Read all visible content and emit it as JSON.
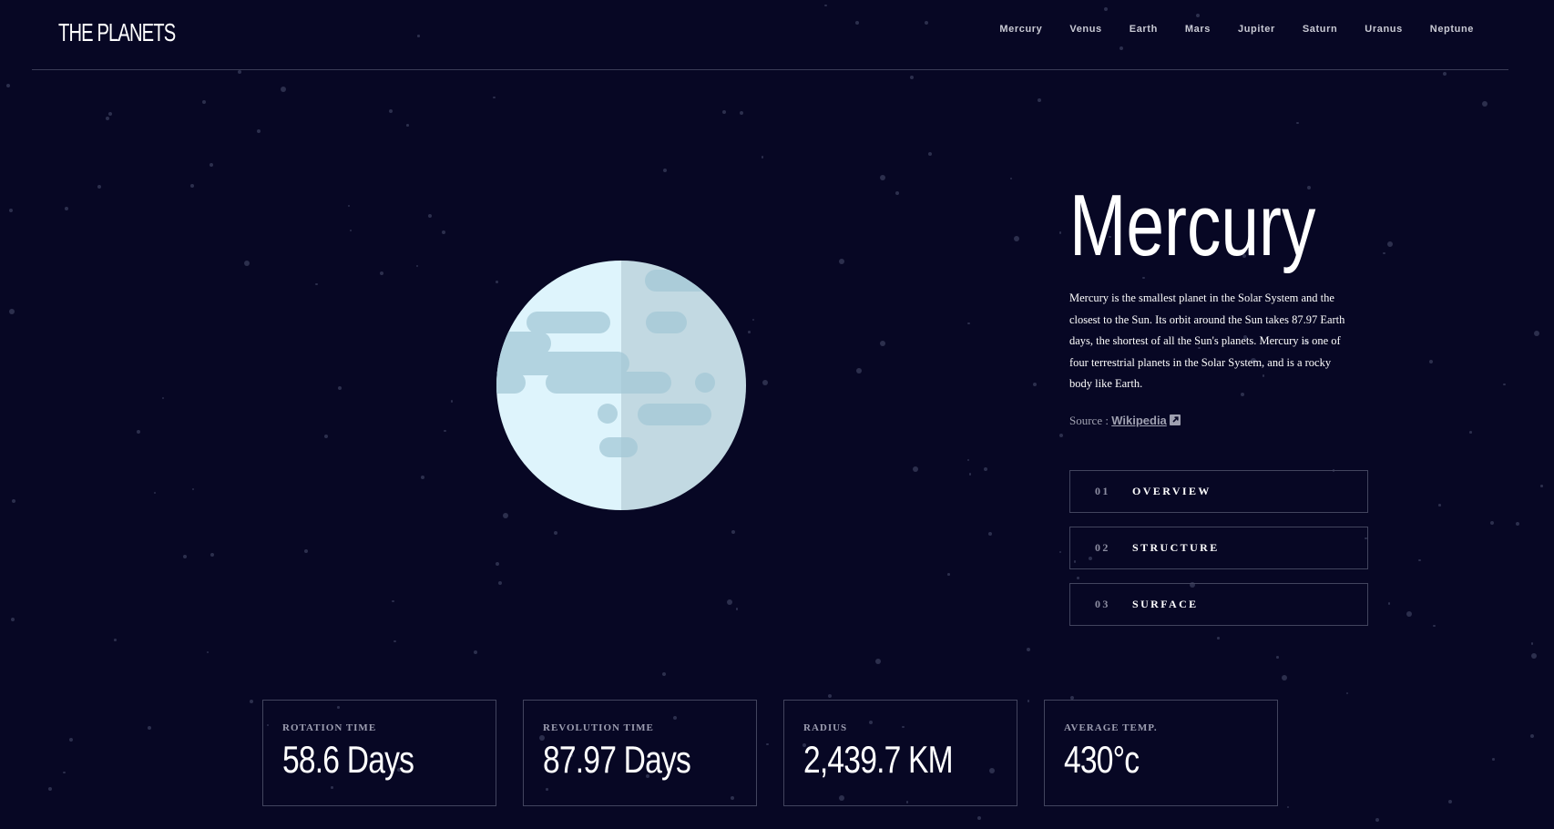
{
  "logo": "THE PLANETS",
  "nav": [
    "Mercury",
    "Venus",
    "Earth",
    "Mars",
    "Jupiter",
    "Saturn",
    "Uranus",
    "Neptune"
  ],
  "planet": {
    "name": "Mercury",
    "description": "Mercury is the smallest planet in the Solar System and the closest to the Sun. Its orbit around the Sun takes 87.97 Earth days, the shortest of all the Sun's planets. Mercury is one of four terrestrial planets in the Solar System, and is a rocky body like Earth.",
    "source_prefix": "Source :",
    "source_link": "Wikipedia"
  },
  "tabs": [
    {
      "num": "01",
      "label": "OVERVIEW"
    },
    {
      "num": "02",
      "label": "STRUCTURE"
    },
    {
      "num": "03",
      "label": "SURFACE"
    }
  ],
  "stats": [
    {
      "label": "ROTATION TIME",
      "value": "58.6 Days"
    },
    {
      "label": "REVOLUTION TIME",
      "value": "87.97 Days"
    },
    {
      "label": "RADIUS",
      "value": "2,439.7 KM"
    },
    {
      "label": "AVERAGE TEMP.",
      "value": "430°c"
    }
  ],
  "colors": {
    "background": "#070724",
    "border": "#42445e",
    "planet_light": "#DEF4FC",
    "planet_shade": "#CCE2EA",
    "planet_spots": "#B2D3E0"
  }
}
